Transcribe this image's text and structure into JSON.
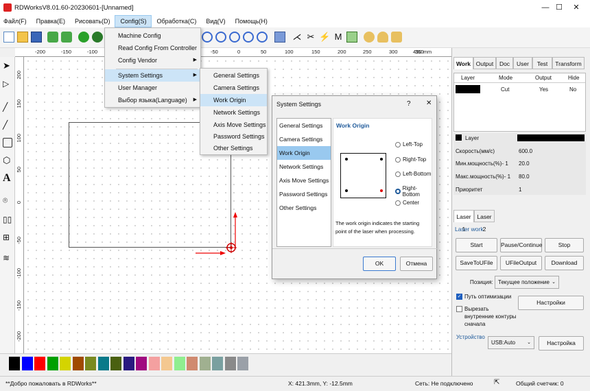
{
  "window": {
    "title": "RDWorksV8.01.60-20230601-[Unnamed]",
    "minimize": "—",
    "maximize": "☐",
    "close": "✕"
  },
  "menubar": [
    "Файл(F)",
    "Правка(E)",
    "Рисовать(D)",
    "Config(S)",
    "Обработка(C)",
    "Вид(V)",
    "Помощь(H)"
  ],
  "config_menu": {
    "items": [
      "Machine Config",
      "Read Config From Controller",
      "Config Vendor",
      "System Settings",
      "User Manager",
      "Выбор языка(Language)"
    ]
  },
  "system_submenu": {
    "items": [
      "General Settings",
      "Camera Settings",
      "Work Origin",
      "Network Settings",
      "Axis Move Settings",
      "Password Settings",
      "Other Settings"
    ]
  },
  "ruler": {
    "h_ticks": [
      "-200",
      "-150",
      "-100",
      "-50",
      "0",
      "50",
      "100",
      "150",
      "200",
      "250",
      "300",
      "350",
      "400",
      "450 mm"
    ],
    "v_ticks": [
      "200",
      "150",
      "100",
      "50",
      "0",
      "-50",
      "-100",
      "-150",
      "-200"
    ]
  },
  "dialog": {
    "title": "System Settings",
    "help": "?",
    "close": "✕",
    "nav": [
      "General Settings",
      "Camera Settings",
      "Work Origin",
      "Network Settings",
      "Axis Move Settings",
      "Password Settings",
      "Other Settings"
    ],
    "selected_nav": "Work Origin",
    "section_title": "Work Origin",
    "options": [
      "Left-Top",
      "Right-Top",
      "Left-Bottom",
      "Right-Bottom",
      "Center"
    ],
    "selected_option": "Right-Bottom",
    "description": "The work origin indicates the starting point of the laser when processing.",
    "ok": "OK",
    "cancel": "Отмена"
  },
  "right_panel": {
    "tabs": [
      "Work",
      "Output",
      "Doc",
      "User",
      "Test",
      "Transform"
    ],
    "layer_table": {
      "headers": [
        "Layer",
        "Mode",
        "Output",
        "Hide"
      ],
      "rows": [
        {
          "mode": "Cut",
          "output": "Yes",
          "hide": "No"
        }
      ]
    },
    "layer_props": {
      "layer_label": "Layer",
      "speed_label": "Скорость(мм/с)",
      "speed": "600.0",
      "minpower_label": "Мин.мощность(%)- 1",
      "minpower": "20.0",
      "maxpower_label": "Макс.мощность(%)- 1",
      "maxpower": "80.0",
      "priority_label": "Приоритет",
      "priority": "1"
    },
    "laser_tabs": [
      "Laser 1",
      "Laser 2"
    ],
    "laser_work_title": "Laser work",
    "buttons": {
      "start": "Start",
      "pause": "Pause/Continue",
      "stop": "Stop",
      "save_u": "SaveToUFile",
      "ufile_output": "UFileOutput",
      "download": "Download",
      "settings": "Настройки",
      "device_settings": "Настройка"
    },
    "position_label": "Позиция:",
    "position_value": "Текущее положение",
    "optimize_label": "Путь оптимизации",
    "cut_inner_label": "Вырезать внутренние контуры сначала",
    "device_title": "Устройство",
    "device_value": "USB:Auto"
  },
  "colors": [
    "#000000",
    "#0000ff",
    "#ff0000",
    "#00a000",
    "#d4d400",
    "#a04a00",
    "#7a8a20",
    "#0a7a8a",
    "#4a6010",
    "#2a1a80",
    "#a00a80",
    "#f4a0a0",
    "#f4c890",
    "#90ee90",
    "#d08a70",
    "#a0b090",
    "#7aa0a0",
    "#8a8a8a",
    "#9aa0a8"
  ],
  "status": {
    "welcome": "**Добро пожаловать в RDWorks**",
    "coords": "X:  421.3mm, Y: -12.5mm",
    "network": "Сеть: Не подключено",
    "counter": "Общий счетчик: 0"
  }
}
